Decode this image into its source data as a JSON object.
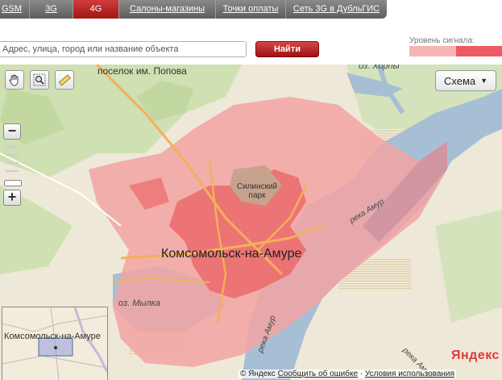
{
  "tabs": [
    {
      "label": "GSM",
      "active": false
    },
    {
      "label": "3G",
      "active": false
    },
    {
      "label": "4G",
      "active": true
    },
    {
      "label": "Салоны-магазины",
      "active": false
    },
    {
      "label": "Точки оплаты",
      "active": false
    },
    {
      "label": "Сеть 3G в ДубльГИС",
      "active": false
    }
  ],
  "search": {
    "placeholder": "Адрес, улица, город или название объекта",
    "button": "Найти"
  },
  "signal": {
    "label": "Уровень сигнала:",
    "colors": [
      "#f7b4b4",
      "#ee5a62"
    ]
  },
  "map": {
    "labels": {
      "village": "поселок им. Попова",
      "lake": "оз. Хорпы",
      "park": "Силинский парк",
      "city": "Комсомольск-на-Амуре",
      "lake2": "оз. Мылка",
      "river1": "река Амур",
      "river2": "река Амур",
      "river3": "река Амур"
    },
    "schema_label": "Схема",
    "minimap_city": "Комсомольск-на-Амуре",
    "logo": "Яндекс"
  },
  "footer": {
    "copyright": "© Яндекс",
    "report": "Сообщить об ошибке",
    "terms": "Условия использования"
  },
  "icons": [
    "hand-icon",
    "magnifier-icon",
    "ruler-icon",
    "chevron-down-icon"
  ]
}
